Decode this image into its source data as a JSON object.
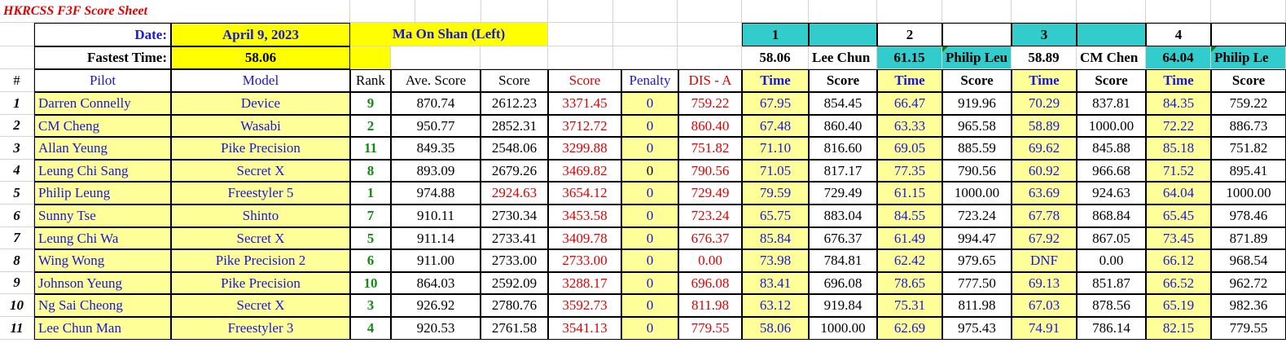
{
  "sheet_title": "HKRCSS F3F Score Sheet",
  "date_label": "Date:",
  "date_value": "April 9, 2023",
  "venue": "Ma On Shan (Left)",
  "fastest_label": "Fastest Time:",
  "fastest_value": "58.06",
  "rounds": [
    {
      "num": "1",
      "fastest": "58.06",
      "name": "Lee Chun"
    },
    {
      "num": "2",
      "fastest": "61.15",
      "name": "Philip Leu"
    },
    {
      "num": "3",
      "fastest": "58.89",
      "name": "CM Chen"
    },
    {
      "num": "4",
      "fastest": "64.04",
      "name": "Philip Le"
    }
  ],
  "headers": {
    "num": "#",
    "pilot": "Pilot",
    "model": "Model",
    "rank": "Rank",
    "ave_score": "Ave. Score",
    "score": "Score",
    "score_red": "Score",
    "penalty": "Penalty",
    "dis": "DIS - A",
    "time": "Time",
    "rscore": "Score"
  },
  "rows": [
    {
      "n": "1",
      "pilot": "Darren Connelly",
      "model": "Device",
      "rank": "9",
      "ave": "870.74",
      "score": "2612.23",
      "score2": "3371.45",
      "pen": "0",
      "dis": "759.22",
      "r": [
        [
          "67.95",
          "854.45"
        ],
        [
          "66.47",
          "919.96"
        ],
        [
          "70.29",
          "837.81"
        ],
        [
          "84.35",
          "759.22"
        ]
      ]
    },
    {
      "n": "2",
      "pilot": "CM Cheng",
      "model": "Wasabi",
      "rank": "2",
      "ave": "950.77",
      "score": "2852.31",
      "score2": "3712.72",
      "pen": "0",
      "dis": "860.40",
      "r": [
        [
          "67.48",
          "860.40"
        ],
        [
          "63.33",
          "965.58"
        ],
        [
          "58.89",
          "1000.00"
        ],
        [
          "72.22",
          "886.73"
        ]
      ]
    },
    {
      "n": "3",
      "pilot": "Allan Yeung",
      "model": "Pike Precision",
      "rank": "11",
      "ave": "849.35",
      "score": "2548.06",
      "score2": "3299.88",
      "pen": "0",
      "dis": "751.82",
      "r": [
        [
          "71.10",
          "816.60"
        ],
        [
          "69.05",
          "885.59"
        ],
        [
          "69.62",
          "845.88"
        ],
        [
          "85.18",
          "751.82"
        ]
      ]
    },
    {
      "n": "4",
      "pilot": "Leung Chi Sang",
      "model": "Secret X",
      "rank": "8",
      "ave": "893.09",
      "score": "2679.26",
      "score2": "3469.82",
      "pen": "0",
      "dis": "790.56",
      "r": [
        [
          "71.05",
          "817.17"
        ],
        [
          "77.35",
          "790.56"
        ],
        [
          "60.92",
          "966.68"
        ],
        [
          "71.52",
          "895.41"
        ]
      ]
    },
    {
      "n": "5",
      "pilot": "Philip Leung",
      "model": "Freestyler 5",
      "rank": "1",
      "ave": "974.88",
      "score": "2924.63",
      "score2": "3654.12",
      "pen": "0",
      "dis": "729.49",
      "r": [
        [
          "79.59",
          "729.49"
        ],
        [
          "61.15",
          "1000.00"
        ],
        [
          "63.69",
          "924.63"
        ],
        [
          "64.04",
          "1000.00"
        ]
      ]
    },
    {
      "n": "6",
      "pilot": "Sunny Tse",
      "model": "Shinto",
      "rank": "7",
      "ave": "910.11",
      "score": "2730.34",
      "score2": "3453.58",
      "pen": "0",
      "dis": "723.24",
      "r": [
        [
          "65.75",
          "883.04"
        ],
        [
          "84.55",
          "723.24"
        ],
        [
          "67.78",
          "868.84"
        ],
        [
          "65.45",
          "978.46"
        ]
      ]
    },
    {
      "n": "7",
      "pilot": "Leung Chi Wa",
      "model": "Secret X",
      "rank": "5",
      "ave": "911.14",
      "score": "2733.41",
      "score2": "3409.78",
      "pen": "0",
      "dis": "676.37",
      "r": [
        [
          "85.84",
          "676.37"
        ],
        [
          "61.49",
          "994.47"
        ],
        [
          "67.92",
          "867.05"
        ],
        [
          "73.45",
          "871.89"
        ]
      ]
    },
    {
      "n": "8",
      "pilot": "Wing Wong",
      "model": "Pike Precision 2",
      "rank": "6",
      "ave": "911.00",
      "score": "2733.00",
      "score2": "2733.00",
      "pen": "0",
      "dis": "0.00",
      "r": [
        [
          "73.98",
          "784.81"
        ],
        [
          "62.42",
          "979.65"
        ],
        [
          "DNF",
          "0.00"
        ],
        [
          "66.12",
          "968.54"
        ]
      ]
    },
    {
      "n": "9",
      "pilot": "Johnson Yeung",
      "model": "Pike Precision",
      "rank": "10",
      "ave": "864.03",
      "score": "2592.09",
      "score2": "3288.17",
      "pen": "0",
      "dis": "696.08",
      "r": [
        [
          "83.41",
          "696.08"
        ],
        [
          "78.65",
          "777.50"
        ],
        [
          "69.13",
          "851.87"
        ],
        [
          "66.52",
          "962.72"
        ]
      ]
    },
    {
      "n": "10",
      "pilot": "Ng Sai Cheong",
      "model": "Secret X",
      "rank": "3",
      "ave": "926.92",
      "score": "2780.76",
      "score2": "3592.73",
      "pen": "0",
      "dis": "811.98",
      "r": [
        [
          "63.12",
          "919.84"
        ],
        [
          "75.31",
          "811.98"
        ],
        [
          "67.03",
          "878.56"
        ],
        [
          "65.19",
          "982.36"
        ]
      ]
    },
    {
      "n": "11",
      "pilot": "Lee Chun Man",
      "model": "Freestyler 3",
      "rank": "4",
      "ave": "920.53",
      "score": "2761.58",
      "score2": "3541.13",
      "pen": "0",
      "dis": "779.55",
      "r": [
        [
          "58.06",
          "1000.00"
        ],
        [
          "62.69",
          "975.43"
        ],
        [
          "74.91",
          "786.14"
        ],
        [
          "82.15",
          "779.55"
        ]
      ]
    }
  ]
}
